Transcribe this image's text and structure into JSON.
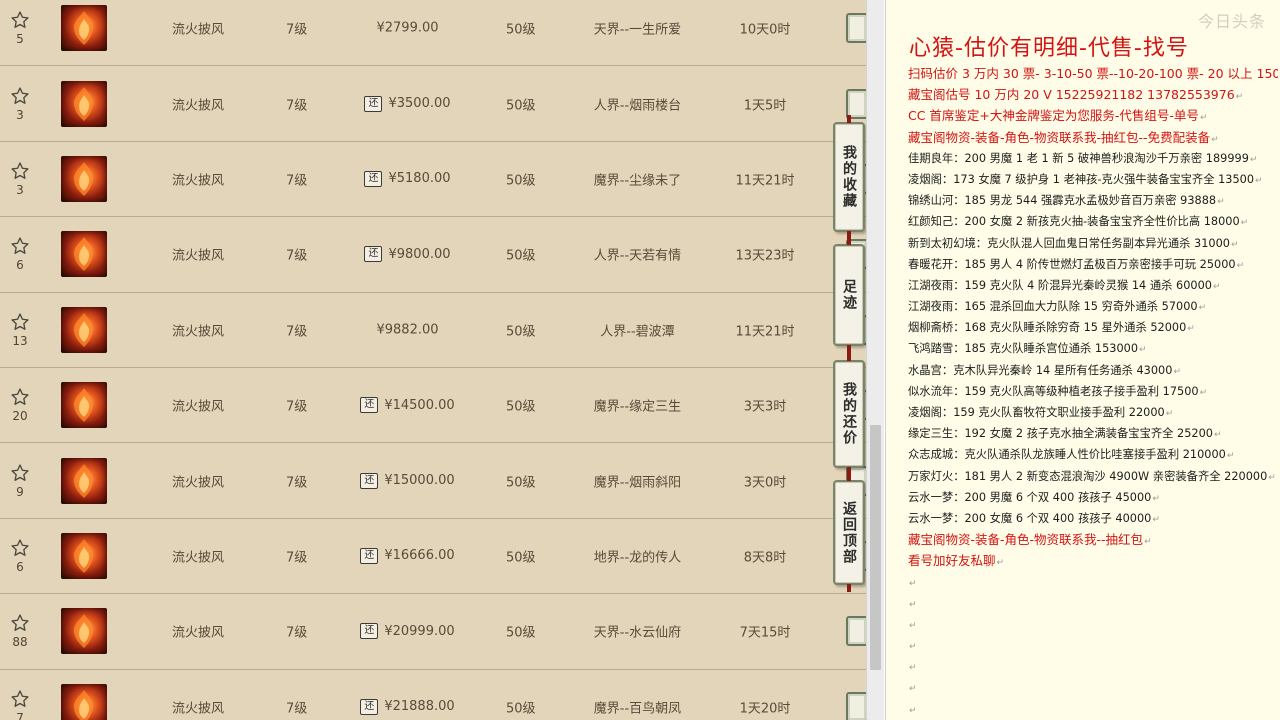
{
  "listing": {
    "rows": [
      {
        "fav_count": "5",
        "name": "流火披风",
        "grade": "7级",
        "price": "¥2799.00",
        "tag": "",
        "level": "50级",
        "server": "天界--一生所爱",
        "time_left": "10天0时"
      },
      {
        "fav_count": "3",
        "name": "流火披风",
        "grade": "7级",
        "price": "¥3500.00",
        "tag": "还",
        "level": "50级",
        "server": "人界--烟雨楼台",
        "time_left": "1天5时"
      },
      {
        "fav_count": "3",
        "name": "流火披风",
        "grade": "7级",
        "price": "¥5180.00",
        "tag": "还",
        "level": "50级",
        "server": "魔界--尘缘未了",
        "time_left": "11天21时"
      },
      {
        "fav_count": "6",
        "name": "流火披风",
        "grade": "7级",
        "price": "¥9800.00",
        "tag": "还",
        "level": "50级",
        "server": "人界--天若有情",
        "time_left": "13天23时"
      },
      {
        "fav_count": "13",
        "name": "流火披风",
        "grade": "7级",
        "price": "¥9882.00",
        "tag": "",
        "level": "50级",
        "server": "人界--碧波潭",
        "time_left": "11天21时"
      },
      {
        "fav_count": "20",
        "name": "流火披风",
        "grade": "7级",
        "price": "¥14500.00",
        "tag": "还",
        "level": "50级",
        "server": "魔界--缘定三生",
        "time_left": "3天3时"
      },
      {
        "fav_count": "9",
        "name": "流火披风",
        "grade": "7级",
        "price": "¥15000.00",
        "tag": "还",
        "level": "50级",
        "server": "魔界--烟雨斜阳",
        "time_left": "3天0时"
      },
      {
        "fav_count": "6",
        "name": "流火披风",
        "grade": "7级",
        "price": "¥16666.00",
        "tag": "还",
        "level": "50级",
        "server": "地界--龙的传人",
        "time_left": "8天8时"
      },
      {
        "fav_count": "88",
        "name": "流火披风",
        "grade": "7级",
        "price": "¥20999.00",
        "tag": "还",
        "level": "50级",
        "server": "天界--水云仙府",
        "time_left": "7天15时"
      },
      {
        "fav_count": "7",
        "name": "流火披风",
        "grade": "7级",
        "price": "¥21888.00",
        "tag": "还",
        "level": "50级",
        "server": "魔界--百鸟朝凤",
        "time_left": "1天20时"
      }
    ]
  },
  "side_nav": {
    "favorites": "我的收藏",
    "footprints": "足迹",
    "bargain": "我的还价",
    "back_to_top": "返回顶部"
  },
  "notes": {
    "watermark": "今日头条",
    "headline": "心猿-估价有明细-代售-找号",
    "lines": [
      {
        "text": "扫码估价 3 万内 30 票- 3-10-50 票--10-20-100 票- 20 以上 150",
        "red": true
      },
      {
        "text": "藏宝阁估号 10 万内 20 V 15225921182   13782553976",
        "red": true
      },
      {
        "text": "CC 首席鉴定+大神金牌鉴定为您服务-代售组号-单号",
        "red": true
      },
      {
        "text": "藏宝阁物资-装备-角色-物资联系我-抽红包--免费配装备",
        "red": true
      },
      {
        "text": "佳期良年：200 男魔 1 老 1 新 5 破神兽秒浪淘沙千万亲密 189999",
        "red": false
      },
      {
        "text": "凌烟阁：173 女魔 7 级护身 1 老神孩-克火强牛装备宝宝齐全 13500",
        "red": false
      },
      {
        "text": "锦绣山河：185 男龙 544 强霹克水孟极妙音百万亲密 93888",
        "red": false
      },
      {
        "text": "红颜知己：200 女魔 2 新孩克火抽-装备宝宝齐全性价比高 18000",
        "red": false
      },
      {
        "text": "新到太初幻境：克火队混人回血鬼日常任务副本异光通杀 31000",
        "red": false
      },
      {
        "text": "春暖花开：185 男人 4 阶传世燃灯孟极百万亲密接手可玩 25000",
        "red": false
      },
      {
        "text": "江湖夜雨：159 克火队 4 阶混异光秦岭灵猴 14 通杀 60000",
        "red": false
      },
      {
        "text": "江湖夜雨：165 混杀回血大力队除 15 穷奇外通杀 57000",
        "red": false
      },
      {
        "text": "烟柳斋桥：168 克火队睡杀除穷奇 15 星外通杀 52000",
        "red": false
      },
      {
        "text": "飞鸿踏雪：185 克火队睡杀宫位通杀 153000",
        "red": false
      },
      {
        "text": "水晶宫：克木队异光秦岭 14 星所有任务通杀 43000",
        "red": false
      },
      {
        "text": "似水流年：159 克火队高等级种植老孩子接手盈利 17500",
        "red": false
      },
      {
        "text": "凌烟阁：159 克火队畜牧符文职业接手盈利 22000",
        "red": false
      },
      {
        "text": "缘定三生：192 女魔 2 孩子克水抽全满装备宝宝齐全 25200",
        "red": false
      },
      {
        "text": "众志成城：克火队通杀队龙族睡人性价比哇塞接手盈利 210000",
        "red": false
      },
      {
        "text": "万家灯火：181 男人 2 新变态混浪淘沙 4900W 亲密装备齐全 220000",
        "red": false
      },
      {
        "text": "云水一梦：200 男魔 6 个双 400 孩孩子 45000",
        "red": false
      },
      {
        "text": "云水一梦：200 女魔 6 个双 400 孩孩子 40000",
        "red": false
      },
      {
        "text": "藏宝阁物资-装备-角色-物资联系我--抽红包",
        "red": true
      },
      {
        "text": "看号加好友私聊",
        "red": true
      },
      {
        "text": "",
        "red": false
      },
      {
        "text": "",
        "red": false
      },
      {
        "text": "",
        "red": false
      },
      {
        "text": "",
        "red": false
      },
      {
        "text": "",
        "red": false
      },
      {
        "text": "",
        "red": false
      },
      {
        "text": "",
        "red": false
      }
    ]
  },
  "colors": {
    "listing_bg": "#e2d5b9",
    "notes_bg": "#fffde7",
    "accent_red": "#d21414"
  },
  "icons": {
    "favorite": "star-outline-icon",
    "item": "flame-cloak-icon",
    "bargain_tag": "bargain-tag-icon",
    "paragraph_mark": "↵"
  }
}
